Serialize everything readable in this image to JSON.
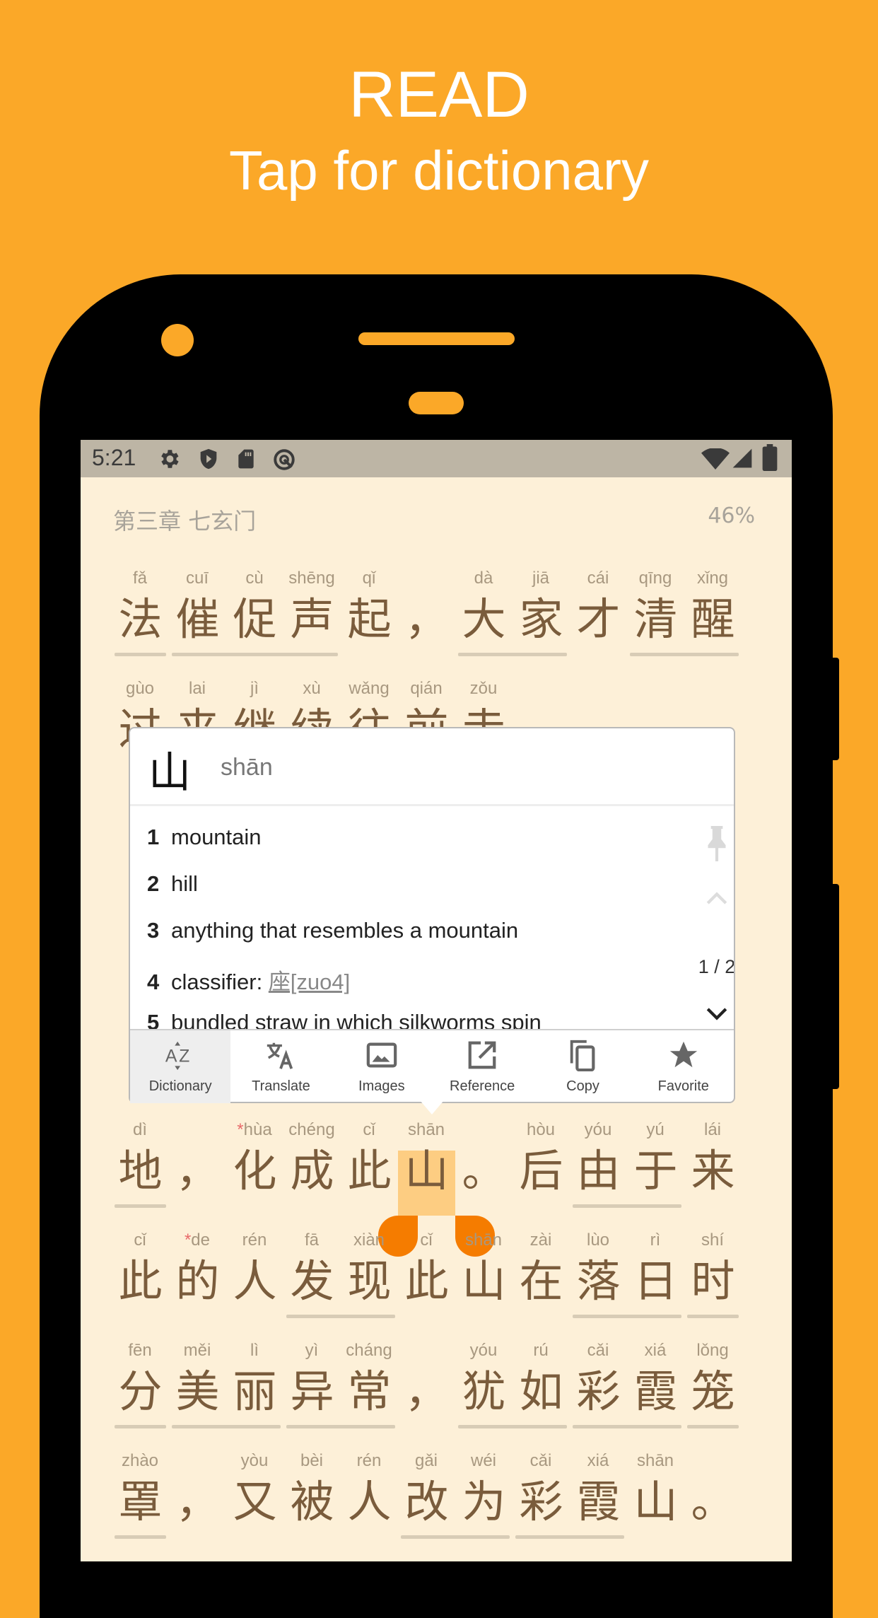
{
  "hero": {
    "title": "READ",
    "subtitle": "Tap for dictionary"
  },
  "status_bar": {
    "time": "5:21",
    "left_icons": [
      "gear-icon",
      "shield-icon",
      "sd-card-icon",
      "data-saver-icon"
    ],
    "right_icons": [
      "wifi-icon",
      "signal-icon",
      "battery-icon"
    ]
  },
  "reader": {
    "chapter_title": "第三章 七玄门",
    "progress": "46%",
    "rows": [
      {
        "row": 0,
        "words": [
          [
            [
              "法",
              "fǎ"
            ]
          ],
          [
            [
              "催",
              "cuī"
            ],
            [
              "促",
              "cù"
            ],
            [
              "声",
              "shēng"
            ]
          ],
          [
            [
              "起",
              "qǐ",
              "n"
            ]
          ],
          [
            [
              "，",
              ""
            ]
          ],
          [
            [
              "大",
              "dà"
            ],
            [
              "家",
              "jiā"
            ]
          ],
          [
            [
              "才",
              "cái",
              "n"
            ]
          ],
          [
            [
              "清",
              "qīng"
            ],
            [
              "醒",
              "xǐng"
            ]
          ]
        ]
      },
      {
        "row": 1,
        "words": [
          [
            [
              "过",
              "gùo",
              "n"
            ]
          ],
          [
            [
              "来",
              "lai",
              "n"
            ]
          ],
          [
            [
              "继",
              "jì",
              "n"
            ]
          ],
          [
            [
              "续",
              "xù",
              "n"
            ]
          ],
          [
            [
              "往",
              "wǎng",
              "n"
            ]
          ],
          [
            [
              "前",
              "qián",
              "n"
            ]
          ],
          [
            [
              "走",
              "zǒu",
              "n"
            ]
          ]
        ]
      },
      {
        "row": 5,
        "words": [
          [
            [
              "地",
              "dì"
            ]
          ],
          [
            [
              "，",
              ""
            ]
          ],
          [
            [
              "化",
              "*hùa",
              "n"
            ]
          ],
          [
            [
              "成",
              "chéng",
              "n"
            ]
          ],
          [
            [
              "此",
              "cǐ",
              "n"
            ]
          ],
          [
            [
              "山",
              "shān",
              "n"
            ]
          ],
          [
            [
              "。",
              ""
            ]
          ],
          [
            [
              "后",
              "hòu",
              "n"
            ]
          ],
          [
            [
              "由",
              "yóu"
            ],
            [
              "于",
              "yú"
            ]
          ],
          [
            [
              "来",
              "lái",
              "n"
            ]
          ]
        ]
      },
      {
        "row": 6,
        "words": [
          [
            [
              "此",
              "cǐ",
              "n"
            ]
          ],
          [
            [
              "的",
              "*de",
              "n"
            ]
          ],
          [
            [
              "人",
              "rén",
              "n"
            ]
          ],
          [
            [
              "发",
              "fā"
            ],
            [
              "现",
              "xiàn"
            ]
          ],
          [
            [
              "此",
              "cǐ",
              "n"
            ]
          ],
          [
            [
              "山",
              "shān",
              "n"
            ]
          ],
          [
            [
              "在",
              "zài",
              "n"
            ]
          ],
          [
            [
              "落",
              "lùo"
            ],
            [
              "日",
              "rì"
            ]
          ],
          [
            [
              "时",
              "shí"
            ]
          ]
        ]
      },
      {
        "row": 7,
        "words": [
          [
            [
              "分",
              "fēn"
            ]
          ],
          [
            [
              "美",
              "měi"
            ],
            [
              "丽",
              "lì"
            ]
          ],
          [
            [
              "异",
              "yì"
            ],
            [
              "常",
              "cháng"
            ]
          ],
          [
            [
              "，",
              ""
            ]
          ],
          [
            [
              "犹",
              "yóu"
            ],
            [
              "如",
              "rú"
            ]
          ],
          [
            [
              "彩",
              "cǎi"
            ],
            [
              "霞",
              "xiá"
            ]
          ],
          [
            [
              "笼",
              "lǒng"
            ]
          ]
        ]
      },
      {
        "row": 8,
        "words": [
          [
            [
              "罩",
              "zhào"
            ]
          ],
          [
            [
              "，",
              ""
            ]
          ],
          [
            [
              "又",
              "yòu",
              "n"
            ]
          ],
          [
            [
              "被",
              "bèi",
              "n"
            ]
          ],
          [
            [
              "人",
              "rén",
              "n"
            ]
          ],
          [
            [
              "改",
              "gǎi"
            ],
            [
              "为",
              "wéi"
            ]
          ],
          [
            [
              "彩",
              "cǎi"
            ],
            [
              "霞",
              "xiá"
            ]
          ],
          [
            [
              "山",
              "shān",
              "n"
            ]
          ],
          [
            [
              "。",
              ""
            ]
          ]
        ]
      }
    ],
    "selected": {
      "row": 5,
      "col": 5
    },
    "highlight_color": "#fdcd82",
    "handle_color": "#f57c00"
  },
  "popup": {
    "character": "山",
    "pinyin": "shān",
    "definitions": [
      {
        "n": "1",
        "text": "mountain"
      },
      {
        "n": "2",
        "text": "hill"
      },
      {
        "n": "3",
        "text": "anything that resembles a mountain"
      },
      {
        "n": "4",
        "text": "classifier: ",
        "link": "座[zuo4]"
      },
      {
        "n": "5",
        "text": "bundled straw in which silkworms spin"
      }
    ],
    "pager": "1 / 2",
    "toolbar": [
      {
        "label": "Dictionary",
        "icon": "sort-az-icon",
        "active": true
      },
      {
        "label": "Translate",
        "icon": "translate-icon"
      },
      {
        "label": "Images",
        "icon": "image-icon"
      },
      {
        "label": "Reference",
        "icon": "open-external-icon"
      },
      {
        "label": "Copy",
        "icon": "copy-icon"
      },
      {
        "label": "Favorite",
        "icon": "star-icon"
      }
    ]
  }
}
